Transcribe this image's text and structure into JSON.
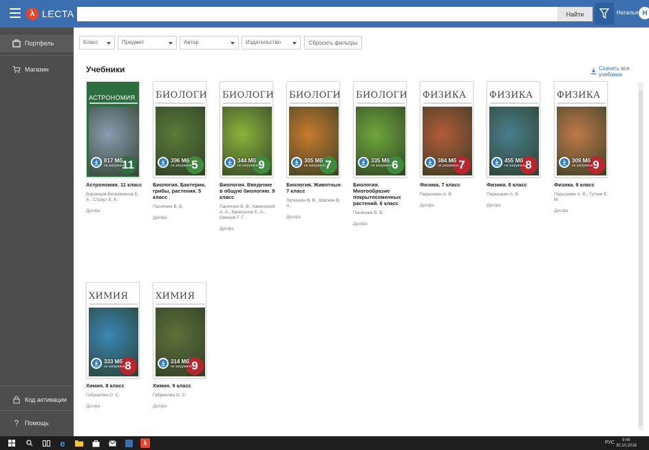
{
  "app": {
    "logo_text": "LECTA"
  },
  "header": {
    "search_placeholder": "",
    "search_button": "Найти",
    "user_name": "Наталья",
    "avatar_letter": "Н"
  },
  "sidebar": {
    "items": [
      {
        "label": "Портфель",
        "icon": "briefcase-icon"
      },
      {
        "label": "Магазин",
        "icon": "cart-icon"
      },
      {
        "label": "Код активации",
        "icon": "lock-icon"
      },
      {
        "label": "Помощь",
        "icon": "question-icon"
      }
    ]
  },
  "filters": {
    "class_label": "Класс",
    "subject_label": "Предмет",
    "author_label": "Автор",
    "publisher_label": "Издательство",
    "reset_label": "Сбросить фильтры"
  },
  "main": {
    "title": "Учебники",
    "download_all": "Скачать все учебники"
  },
  "books": [
    {
      "cover_title": "АСТРОНОМИЯ",
      "grade": "11",
      "size": "817 Мб",
      "status": "не загружено",
      "title": "Астрономия. 11 класс",
      "authors": "Воронцов-Вельяминов Б. А., Страут Е. К.",
      "publisher": "Дрофа",
      "cover_color": "#2c6e3f",
      "art_color": "#8a9bb0",
      "grade_color": "#2c6e3f"
    },
    {
      "cover_title": "БИОЛОГИЯ",
      "grade": "5",
      "size": "396 Мб",
      "status": "не загружено",
      "title": "Биология. Бактерии, грибы, растения. 5 класс",
      "authors": "Пасечник В. В.",
      "publisher": "Дрофа",
      "cover_color": "#ffffff",
      "art_color": "#5b7a3a",
      "grade_color": "#3f8a3c"
    },
    {
      "cover_title": "БИОЛОГИЯ",
      "grade": "9",
      "size": "344 Мб",
      "status": "не загружено",
      "title": "Биология. Введение в общую биологию. 9 класс",
      "authors": "Пасечник В. В., Каменский А. А., Криксунов Е. А., Швецов Г. Г.",
      "publisher": "Дрофа",
      "cover_color": "#ffffff",
      "art_color": "#8bb23c",
      "grade_color": "#3f8a3c"
    },
    {
      "cover_title": "БИОЛОГИЯ",
      "grade": "7",
      "size": "305 Мб",
      "status": "не загружено",
      "title": "Биология. Животные. 7 класс",
      "authors": "Латюшин В. В., Шапкин В. А.",
      "publisher": "Дрофа",
      "cover_color": "#ffffff",
      "art_color": "#c97a2e",
      "grade_color": "#3f8a3c"
    },
    {
      "cover_title": "БИОЛОГИЯ",
      "grade": "6",
      "size": "335 Мб",
      "status": "не загружено",
      "title": "Биология. Многообразие покрытосеменных растений. 6 класс",
      "authors": "Пасечник В. В.",
      "publisher": "Дрофа",
      "cover_color": "#ffffff",
      "art_color": "#6ea63b",
      "grade_color": "#3f8a3c"
    },
    {
      "cover_title": "ФИЗИКА",
      "grade": "7",
      "size": "384 Мб",
      "status": "не загружено",
      "title": "Физика. 7 класс",
      "authors": "Перышкин А. В.",
      "publisher": "Дрофа",
      "cover_color": "#ffffff",
      "art_color": "#b35a3a",
      "grade_color": "#b8262e"
    },
    {
      "cover_title": "ФИЗИКА",
      "grade": "8",
      "size": "455 Мб",
      "status": "не загружено",
      "title": "Физика. 8 класс",
      "authors": "Перышкин А. В.",
      "publisher": "Дрофа",
      "cover_color": "#ffffff",
      "art_color": "#4a7e8e",
      "grade_color": "#b8262e"
    },
    {
      "cover_title": "ФИЗИКА",
      "grade": "9",
      "size": "309 Мб",
      "status": "не загружено",
      "title": "Физика. 9 класс",
      "authors": "Перышкин А. В., Гутник Е. М.",
      "publisher": "Дрофа",
      "cover_color": "#ffffff",
      "art_color": "#c07a4a",
      "grade_color": "#b8262e"
    },
    {
      "cover_title": "ХИМИЯ",
      "grade": "8",
      "size": "333 Мб",
      "status": "не загружено",
      "title": "Химия. 8 класс",
      "authors": "Габриелян О. С.",
      "publisher": "Дрофа",
      "cover_color": "#ffffff",
      "art_color": "#3a86b5",
      "grade_color": "#b8262e"
    },
    {
      "cover_title": "ХИМИЯ",
      "grade": "9",
      "size": "314 Мб",
      "status": "не загружено",
      "title": "Химия. 9 класс",
      "authors": "Габриелян О. С.",
      "publisher": "Дрофа",
      "cover_color": "#ffffff",
      "art_color": "#5f6f3a",
      "grade_color": "#b8262e"
    }
  ],
  "taskbar": {
    "lang": "РУС",
    "time": "9:45",
    "date": "30.10.2018"
  }
}
